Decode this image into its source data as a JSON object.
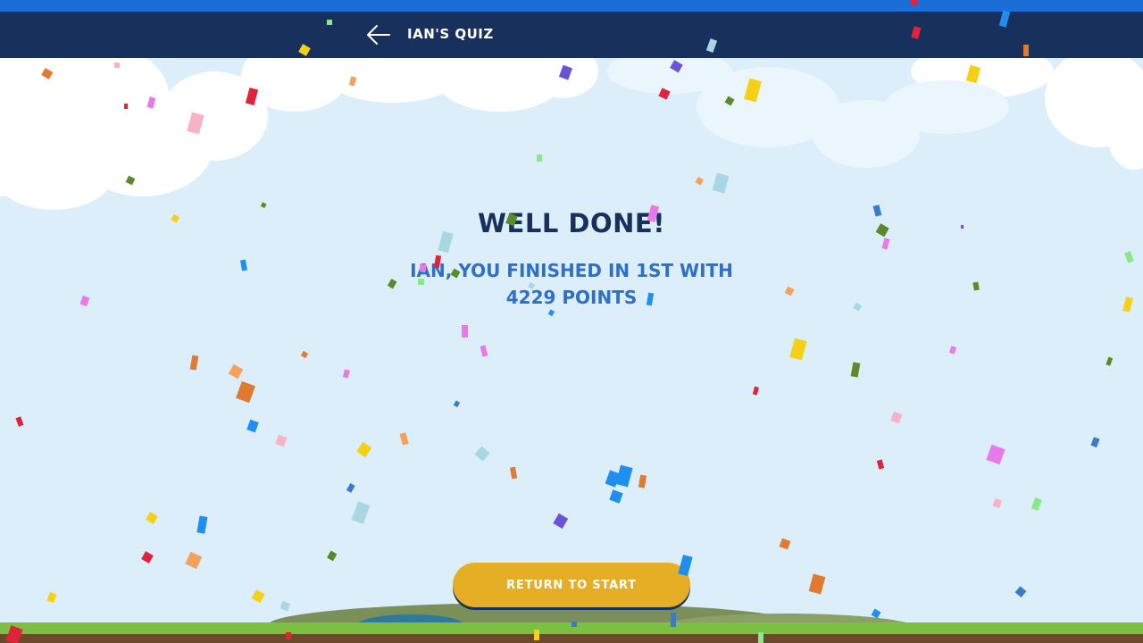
{
  "header": {
    "title": "IAN'S QUIZ",
    "back_icon": "arrow-left-icon"
  },
  "result": {
    "heading": "WELL DONE!",
    "message": "IAN, YOU FINISHED IN 1ST WITH 4229 POINTS"
  },
  "actions": {
    "return_label": "RETURN TO START"
  },
  "colors": {
    "header_bg": "#17305c",
    "top_stripe": "#1a6fd6",
    "sky": "#dbeef9",
    "heading": "#17305c",
    "message": "#2f6fc7",
    "button": "#e6ae25",
    "grass": "#7cc043"
  }
}
